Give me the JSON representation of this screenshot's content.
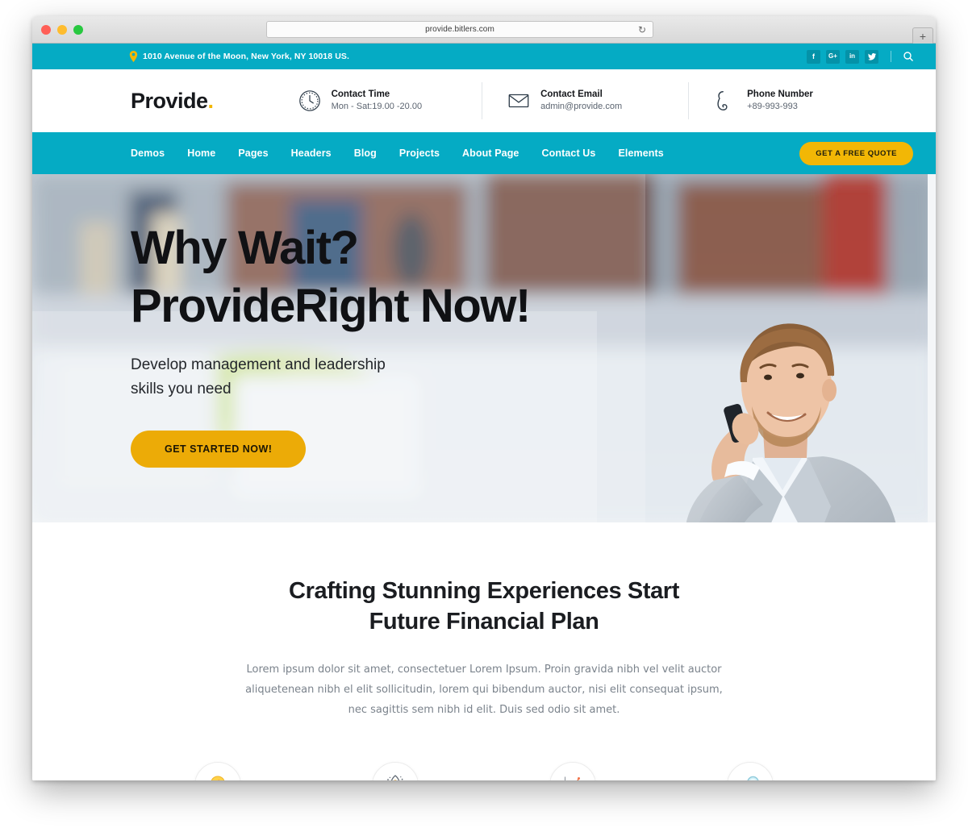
{
  "browser": {
    "url": "provide.bitlers.com",
    "reload_icon": "reload-icon",
    "newtab_label": "+",
    "traffic_lights": [
      "close",
      "minimize",
      "maximize"
    ]
  },
  "topbar": {
    "pin_icon": "location-pin-icon",
    "address": "1010 Avenue of the Moon, New York, NY 10018 US.",
    "socials": [
      {
        "name": "facebook",
        "glyph": "f"
      },
      {
        "name": "google-plus",
        "glyph": "G+"
      },
      {
        "name": "linkedin",
        "glyph": "in"
      },
      {
        "name": "twitter",
        "glyph": "t"
      }
    ],
    "search_icon": "search-icon",
    "bg_color": "#05ABC4"
  },
  "header": {
    "logo_text": "Provide",
    "logo_dot": ".",
    "logo_dot_color": "#F2B705",
    "contacts": [
      {
        "icon": "clock-icon",
        "title": "Contact Time",
        "value": "Mon - Sat:19.00 -20.00"
      },
      {
        "icon": "envelope-icon",
        "title": "Contact Email",
        "value": "admin@provide.com"
      },
      {
        "icon": "phone-icon",
        "title": "Phone Number",
        "value": "+89-993-993"
      }
    ]
  },
  "nav": {
    "items": [
      {
        "label": "Demos"
      },
      {
        "label": "Home"
      },
      {
        "label": "Pages"
      },
      {
        "label": "Headers"
      },
      {
        "label": "Blog"
      },
      {
        "label": "Projects"
      },
      {
        "label": "About Page"
      },
      {
        "label": "Contact Us"
      },
      {
        "label": "Elements"
      }
    ],
    "cta_label": "GET A FREE QUOTE",
    "cta_color": "#F2B705",
    "bg_color": "#05ABC4"
  },
  "hero": {
    "title_line1": "Why Wait?",
    "title_line2": "ProvideRight Now!",
    "subtitle_line1": "Develop management and leadership",
    "subtitle_line2": "skills you need",
    "button_label": "GET STARTED NOW!",
    "button_color": "#ECAB07",
    "image_alt": "businessman-on-phone-with-coffee"
  },
  "features": {
    "title_line1": "Crafting Stunning Experiences Start",
    "title_line2": "Future Financial Plan",
    "paragraph": "Lorem ipsum dolor sit amet, consectetuer Lorem Ipsum. Proin gravida nibh vel velit auctor aliquetenean nibh el elit sollicitudin, lorem qui bibendum auctor, nisi elit consequat ipsum, nec sagittis sem nibh id elit. Duis sed odio sit amet.",
    "icons": [
      {
        "name": "lightbulb-bolt-icon"
      },
      {
        "name": "rocket-icon"
      },
      {
        "name": "growth-chart-icon"
      },
      {
        "name": "magnifier-icon"
      }
    ]
  }
}
